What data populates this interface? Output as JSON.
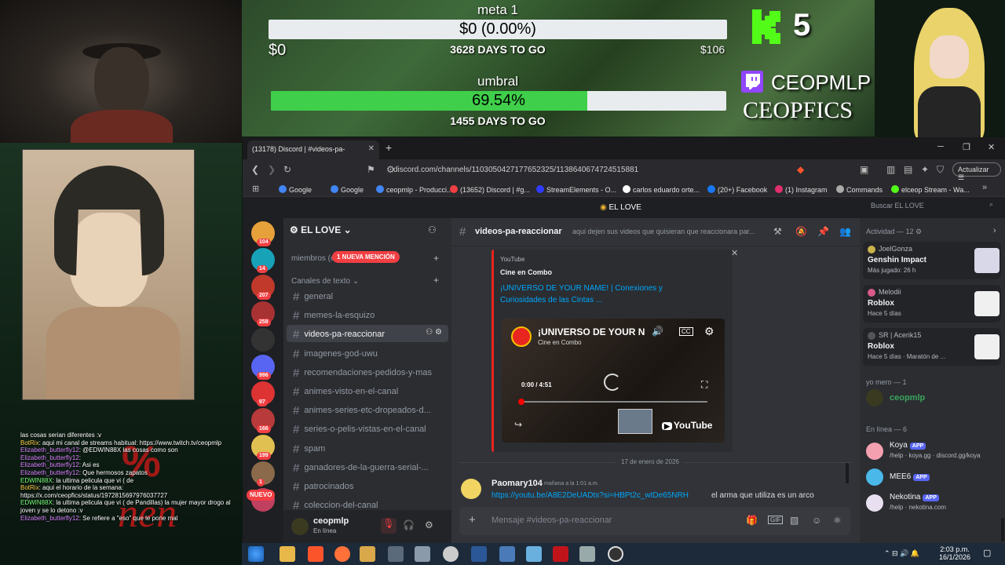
{
  "overlay": {
    "meta_title": "meta 1",
    "meta_bar_text": "$0 (0.00%)",
    "meta_left": "$0",
    "meta_days": "3628 DAYS TO GO",
    "meta_right": "$106",
    "meta_progress": 0.0,
    "umbral_title": "umbral",
    "umbral_bar_text": "69.54%",
    "umbral_progress": 0.6954,
    "umbral_days": "1455 DAYS TO GO",
    "kick_count": "5",
    "twitch_name": "CEOPMLP",
    "name2": "CEOPFICS"
  },
  "chat_overlay": {
    "lines": [
      {
        "user": "",
        "text": "las cosas serian diferentes :v",
        "color": "white"
      },
      {
        "user": "BotRix",
        "text": "aqui mi canal de streams habitual: https://www.twitch.tv/ceopmlp",
        "color": "yellow"
      },
      {
        "user": "Elizabeth_butterfly12",
        "text": "@EDWIN88X las cosas como son",
        "color": "purple"
      },
      {
        "user": "Elizabeth_butterfly12",
        "text": "",
        "color": "purple"
      },
      {
        "user": "Elizabeth_butterfly12",
        "text": "Asi es",
        "color": "purple"
      },
      {
        "user": "Elizabeth_butterfly12",
        "text": "Que hermosos zapatos",
        "color": "purple"
      },
      {
        "user": "EDWIN88X",
        "text": "la ultima pelicula que vi ( de",
        "color": "green"
      },
      {
        "user": "BotRix",
        "text": "aqui el horario de la semana: https://x.com/ceopfics/status/1972815697976037727",
        "color": "yellow"
      },
      {
        "user": "EDWIN88X",
        "text": "la ultima pelicula que vi ( de Pandillas) la mujer mayor drogo al joven y se lo detono :v",
        "color": "green"
      },
      {
        "user": "Elizabeth_butterfly12",
        "text": "Se refiere a \"eso\" que le pone mal",
        "color": "purple"
      }
    ]
  },
  "watermark": {
    "percent": "%",
    "text": "nen"
  },
  "browser": {
    "tab_title": "(13178) Discord | #videos-pa-",
    "url": "discord.com/channels/1103050427177652325/1138640674724515881",
    "update_label": "Actualizar",
    "bookmarks": [
      {
        "label": "Google",
        "color": "#4285f4"
      },
      {
        "label": "Google",
        "color": "#4285f4"
      },
      {
        "label": "ceopmlp - Producci...",
        "color": "#4285f4"
      },
      {
        "label": "(13652) Discord | #g...",
        "color": "#f23f43"
      },
      {
        "label": "StreamElements - O...",
        "color": "#2f3bff"
      },
      {
        "label": "carlos eduardo orte...",
        "color": "#ffffff"
      },
      {
        "label": "(20+) Facebook",
        "color": "#1877f2"
      },
      {
        "label": "(1) Instagram",
        "color": "#e1306c"
      },
      {
        "label": "Commands",
        "color": "#aaaaaa"
      },
      {
        "label": "elceop Stream - Wa...",
        "color": "#53fc18"
      }
    ]
  },
  "discord": {
    "app_title": "EL LOVE",
    "server_name": "EL LOVE",
    "members_label": "miembros (e",
    "mention_pill": "1 NUEVA MENCIÓN",
    "category": "Canales de texto",
    "channels": [
      {
        "name": "general",
        "active": false
      },
      {
        "name": "memes-la-esquizo",
        "active": false
      },
      {
        "name": "videos-pa-reaccionar",
        "active": true
      },
      {
        "name": "imagenes-god-uwu",
        "active": false
      },
      {
        "name": "recomendaciones-pedidos-y-mas",
        "active": false
      },
      {
        "name": "animes-visto-en-el-canal",
        "active": false
      },
      {
        "name": "animes-series-etc-dropeados-d...",
        "active": false
      },
      {
        "name": "series-o-pelis-vistas-en-el-canal",
        "active": false
      },
      {
        "name": "spam",
        "active": false
      },
      {
        "name": "ganadores-de-la-guerra-serial-...",
        "active": false
      },
      {
        "name": "patrocinados",
        "active": false
      },
      {
        "name": "coleccion-del-canal",
        "active": false
      }
    ],
    "server_badges": [
      "104",
      "14",
      "207",
      "258",
      "",
      "996",
      "97",
      "166",
      "199",
      "1",
      ""
    ],
    "new_label": "NUEVO",
    "user": {
      "name": "ceopmlp",
      "status": "En línea"
    },
    "channel_header": "videos-pa-reaccionar",
    "channel_topic": "aqui dejen sus videos que quisieran que reaccionara par...",
    "search_placeholder": "Buscar EL LOVE",
    "embed": {
      "provider": "YouTube",
      "author": "Cine en Combo",
      "title": "¡UNIVERSO DE YOUR NAME! | Conexiones y Curiosidades de las Cintas ...",
      "player_title": "¡UNIVERSO DE YOUR N",
      "player_channel": "Cine en Combo",
      "time": "0:00 / 4:51",
      "yt_label": "YouTube"
    },
    "date_divider": "17 de enero de 2026",
    "message": {
      "author": "Paomary104",
      "timestamp": "mañana a la 1:01 a.m.",
      "link": "https://youtu.be/A8E2DeUADts?si=HBPt2c_wtDe65NRH",
      "text": "el arma que utiliza es un arco"
    },
    "input_placeholder": "Mensaje #videos-pa-reaccionar",
    "members": {
      "activity_title": "Actividad — 12",
      "activity": [
        {
          "name": "JoelGonza",
          "game": "Genshin Impact",
          "sub": "Más jugado: 26 h"
        },
        {
          "name": "Melodii",
          "game": "Roblox",
          "sub": "Hace 5 días"
        },
        {
          "name": "SR | Acerik15",
          "game": "Roblox",
          "sub": "Hace 5 días · Maratón de ..."
        }
      ],
      "yo_mero_title": "yo mero — 1",
      "yo_mero": "ceopmlp",
      "online_title": "En línea — 6",
      "online": [
        {
          "name": "Koya",
          "sub": "/help · koya.gg · discord.gg/koya"
        },
        {
          "name": "MEE6",
          "sub": ""
        },
        {
          "name": "Nekotina",
          "sub": "/help · nekotina.com"
        }
      ],
      "app_badge": "APP"
    }
  },
  "taskbar": {
    "time": "2:03 p.m.",
    "date": "16/1/2026"
  }
}
